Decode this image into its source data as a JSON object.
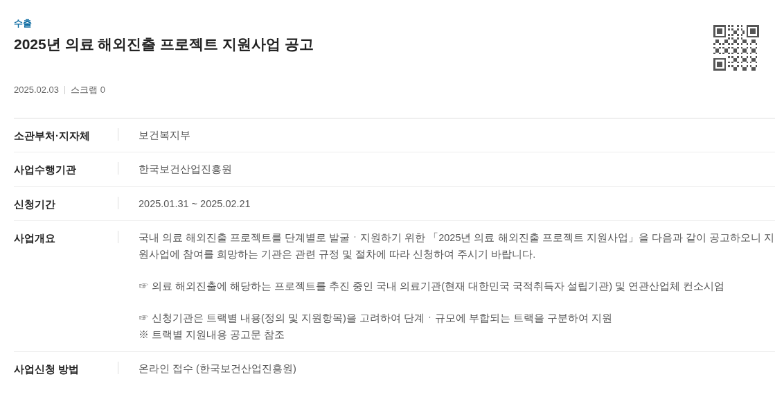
{
  "category": "수출",
  "title": "2025년 의료 해외진출 프로젝트 지원사업 공고",
  "meta": {
    "date": "2025.02.03",
    "scrap": "스크랩 0"
  },
  "rows": [
    {
      "label": "소관부처·지자체",
      "blocks": [
        [
          "보건복지부"
        ]
      ]
    },
    {
      "label": "사업수행기관",
      "blocks": [
        [
          "한국보건산업진흥원"
        ]
      ]
    },
    {
      "label": "신청기간",
      "blocks": [
        [
          "2025.01.31 ~ 2025.02.21"
        ]
      ]
    },
    {
      "label": "사업개요",
      "blocks": [
        [
          "국내 의료 해외진출 프로젝트를 단계별로 발굴ㆍ지원하기 위한 「2025년 의료 해외진출 프로젝트 지원사업」을 다음과 같이 공고하오니 지원사업에 참여를 희망하는 기관은 관련 규정 및 절차에 따라 신청하여 주시기 바랍니다."
        ],
        [
          "☞ 의료 해외진출에 해당하는 프로젝트를 추진 중인 국내 의료기관(현재 대한민국 국적취득자 설립기관) 및 연관산업체 컨소시엄"
        ],
        [
          "☞ 신청기관은 트랙별 내용(정의 및 지원항목)을 고려하여 단계ㆍ규모에 부합되는 트랙을 구분하여 지원",
          "※ 트랙별 지원내용 공고문 참조"
        ]
      ]
    },
    {
      "label": "사업신청 방법",
      "blocks": [
        [
          "온라인 접수 (한국보건산업진흥원)"
        ]
      ]
    }
  ]
}
